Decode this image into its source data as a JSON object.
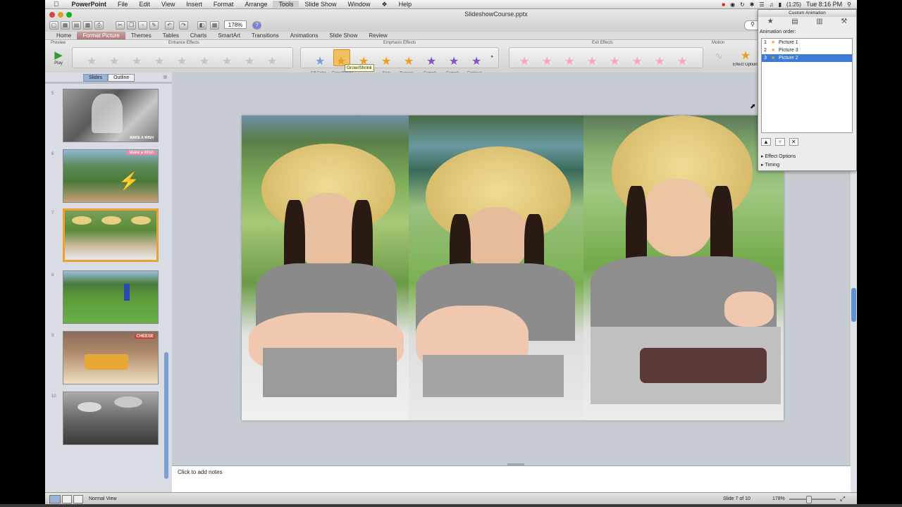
{
  "menubar": {
    "app_name": "PowerPoint",
    "items": [
      "File",
      "Edit",
      "View",
      "Insert",
      "Format",
      "Arrange",
      "Tools",
      "Slide Show",
      "Window",
      "Help"
    ],
    "battery": "(1:25)",
    "clock": "Tue 8:16 PM"
  },
  "window": {
    "title": "SlideshowCourse.pptx",
    "zoom": "178%"
  },
  "ribbon_tabs": [
    "Home",
    "Format Picture",
    "Themes",
    "Tables",
    "Charts",
    "SmartArt",
    "Transitions",
    "Animations",
    "Slide Show",
    "Review"
  ],
  "ribbon": {
    "groups": {
      "preview": "Preview",
      "entrance": "Entrance Effects",
      "emphasis": "Emphasis Effects",
      "exit": "Exit Effects",
      "motion": "Motion"
    },
    "play_label": "Play",
    "emphasis_items": [
      "Fill Color",
      "Grow/Shrink",
      "Spin",
      "Transpa...",
      "Comple...",
      "Comple...",
      "Contrast..."
    ],
    "effect_options_label": "Effect Options",
    "tooltip": "Grow/Shrink",
    "accent_active_tab": "#b07a7a"
  },
  "slides_panel": {
    "slides_tab": "Slides",
    "outline_tab": "Outline",
    "thumb_captions": {
      "make_a_wish_small": "MAKE A WISH",
      "make_a_wish_banner": "Make a Wish",
      "cheese": "CHEESE"
    }
  },
  "notes_placeholder": "Click to add notes",
  "custom_animation": {
    "title": "Custom Animation",
    "order_label": "Animation order:",
    "items": [
      {
        "num": "1",
        "name": "Picture 1"
      },
      {
        "num": "2",
        "name": "Picture 3"
      },
      {
        "num": "3",
        "name": "Picture 2"
      }
    ],
    "effect_options": "Effect Options",
    "timing": "Timing"
  },
  "status": {
    "view": "Normal View",
    "slide": "Slide 7 of 10",
    "zoom": "178%"
  }
}
